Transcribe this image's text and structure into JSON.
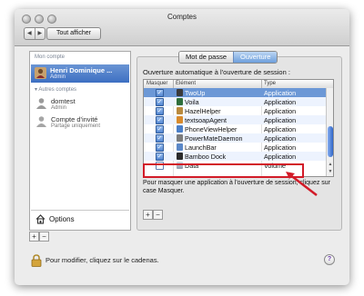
{
  "window": {
    "title": "Comptes",
    "nav_back": "◀",
    "nav_forward": "▶",
    "show_all": "Tout afficher"
  },
  "sidebar": {
    "my_account_header": "Mon compte",
    "current_user": {
      "name": "Henri Dominique ...",
      "role": "Admin"
    },
    "other_accounts_header": "▾ Autres comptes",
    "accounts": [
      {
        "name": "domtest",
        "role": "Admin"
      },
      {
        "name": "Compte d'invité",
        "role": "Partage uniquement"
      }
    ],
    "options_label": "Options",
    "add": "+",
    "remove": "−"
  },
  "tabs": [
    {
      "label": "Mot de passe",
      "active": false
    },
    {
      "label": "Ouverture",
      "active": true
    }
  ],
  "login_items": {
    "instruction": "Ouverture automatique à l'ouverture de session :",
    "columns": {
      "hide": "Masquer",
      "item": "Élément",
      "type": "Type"
    },
    "rows": [
      {
        "hidden": true,
        "name": "TwoUp",
        "type": "Application",
        "icon": "twoup-app-icon",
        "selected": true
      },
      {
        "hidden": true,
        "name": "Voila",
        "type": "Application",
        "icon": "voila-app-icon"
      },
      {
        "hidden": true,
        "name": "HazelHelper",
        "type": "Application",
        "icon": "hazel-app-icon"
      },
      {
        "hidden": true,
        "name": "textsoapAgent",
        "type": "Application",
        "icon": "textsoap-app-icon"
      },
      {
        "hidden": true,
        "name": "PhoneViewHelper",
        "type": "Application",
        "icon": "phoneview-app-icon"
      },
      {
        "hidden": true,
        "name": "PowerMateDaemon",
        "type": "Application",
        "icon": "powermate-app-icon"
      },
      {
        "hidden": true,
        "name": "LaunchBar",
        "type": "Application",
        "icon": "launchbar-app-icon"
      },
      {
        "hidden": true,
        "name": "Bamboo Dock",
        "type": "Application",
        "icon": "bamboo-app-icon"
      },
      {
        "hidden": false,
        "name": "Data",
        "type": "Volume",
        "icon": "volume-icon",
        "highlighted": true
      }
    ],
    "help_text": "Pour masquer une application à l'ouverture de session, cliquez sur case Masquer.",
    "add": "+",
    "remove": "−"
  },
  "footer": {
    "lock_text": "Pour modifier, cliquez sur le cadenas.",
    "help": "?"
  },
  "colors": {
    "selection": "#6c98d6",
    "annotation": "#d21b28",
    "tab_active": "#6d9fdc"
  }
}
